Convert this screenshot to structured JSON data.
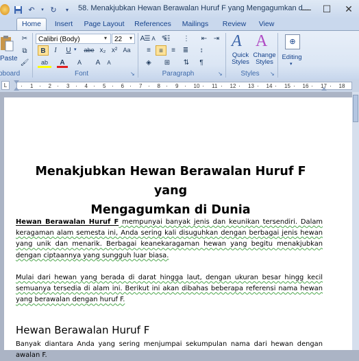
{
  "window": {
    "title": "58. Menakjubkan Hewan Berawalan Huruf F yang Mengagumkan d...",
    "controls": [
      "minimize",
      "maximize",
      "close"
    ]
  },
  "tabs": [
    "Home",
    "Insert",
    "Page Layout",
    "References",
    "Mailings",
    "Review",
    "View"
  ],
  "active_tab": "Home",
  "ribbon": {
    "clipboard": {
      "paste_label": "Paste",
      "group_label": "pboard"
    },
    "font": {
      "font_name": "Calibri (Body)",
      "font_size": "22",
      "group_label": "Font",
      "buttons": [
        "B",
        "I",
        "U",
        "abe",
        "x₂",
        "x²",
        "Aa",
        "A",
        "A"
      ]
    },
    "paragraph": {
      "group_label": "Paragraph"
    },
    "styles": {
      "quick_styles": "Quick Styles",
      "change_styles": "Change Styles",
      "group_label": "Styles"
    },
    "editing": {
      "label": "Editing"
    }
  },
  "ruler": {
    "numbers": [
      "1",
      "2",
      "3",
      "4",
      "5",
      "6",
      "7",
      "8",
      "9",
      "10",
      "11",
      "12",
      "13",
      "14",
      "15",
      "16",
      "17",
      "18"
    ]
  },
  "document": {
    "title_line1": "Menakjubkan Hewan Berawalan Huruf F yang",
    "title_line2": "Mengagumkan di Dunia",
    "p1_bold": "Hewan Berawalan Huruf F",
    "p1_rest": " mempunyai banyak jenis dan keunikan tersendiri. Dalam keragaman alam semesta ini, Anda sering kali disuguhkan dengan berbagai jenis hewan yang unik dan menarik. Berbagai keanekaragaman hewan yang begitu menakjubkan dengan ciptaannya yang sungguh luar biasa.",
    "p2": "Mulai dari hewan yang berada di darat hingga laut, dengan ukuran besar hingg kecil semuanya tersedia di alam ini. Berikut ini akan dibahas beberapa referensi nama hewan yang berawalan dengan huruf F.",
    "heading": "Hewan Berawalan Huruf F",
    "p3": "Banyak diantara Anda yang sering menjumpai sekumpulan nama dari hewan dengan awalan F."
  }
}
